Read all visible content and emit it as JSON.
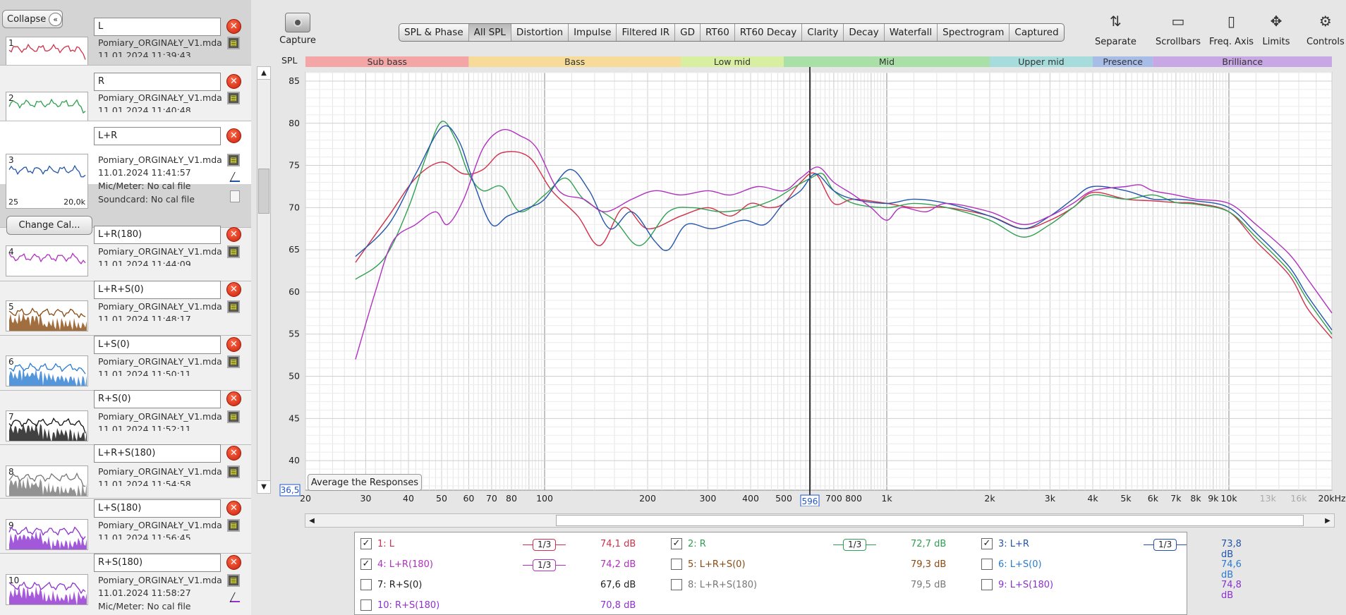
{
  "left_panel": {
    "collapse_label": "Collapse",
    "change_cal_label": "Change Cal...",
    "measurements": [
      {
        "num": "1",
        "name": "L",
        "file": "Pomiary_ORGINAŁY_V1.mdat",
        "date": "11.01.2024 11:39:43",
        "color": "#d0304a"
      },
      {
        "num": "2",
        "name": "R",
        "file": "Pomiary_ORGINAŁY_V1.mdat",
        "date": "11.01.2024 11:40:48",
        "color": "#2fa050"
      },
      {
        "num": "3",
        "name": "L+R",
        "file": "Pomiary_ORGINAŁY_V1.mdat",
        "date": "11.01.2024 11:41:57",
        "color": "#2255aa",
        "mic": "Mic/Meter: No cal file",
        "sound": "Soundcard: No cal file",
        "axis_min": "25",
        "axis_max": "20,0k"
      },
      {
        "num": "4",
        "name": "L+R(180)",
        "file": "Pomiary_ORGINAŁY_V1.mdat",
        "date": "11.01.2024 11:44:09",
        "color": "#b030c0"
      },
      {
        "num": "5",
        "name": "L+R+S(0)",
        "file": "Pomiary_ORGINAŁY_V1.mdat",
        "date": "11.01.2024 11:48:17",
        "color": "#8a4a10"
      },
      {
        "num": "6",
        "name": "L+S(0)",
        "file": "Pomiary_ORGINAŁY_V1.mdat",
        "date": "11.01.2024 11:50:11",
        "color": "#2a7ad0"
      },
      {
        "num": "7",
        "name": "R+S(0)",
        "file": "Pomiary_ORGINAŁY_V1.mdat",
        "date": "11.01.2024 11:52:11",
        "color": "#111111"
      },
      {
        "num": "8",
        "name": "L+R+S(180)",
        "file": "Pomiary_ORGINAŁY_V1.mdat",
        "date": "11.01.2024 11:54:58",
        "color": "#777777"
      },
      {
        "num": "9",
        "name": "L+S(180)",
        "file": "Pomiary_ORGINAŁY_V1.mdat",
        "date": "11.01.2024 11:56:45",
        "color": "#8a30d0"
      },
      {
        "num": "10",
        "name": "R+S(180)",
        "file": "Pomiary_ORGINAŁY_V1.mdat",
        "date": "11.01.2024 11:58:27",
        "color": "#9030d0",
        "mic": "Mic/Meter: No cal file"
      }
    ]
  },
  "toolbar": {
    "capture_label": "Capture",
    "tabs": [
      "SPL & Phase",
      "All SPL",
      "Distortion",
      "Impulse",
      "Filtered IR",
      "GD",
      "RT60",
      "RT60 Decay",
      "Clarity",
      "Decay",
      "Waterfall",
      "Spectrogram",
      "Captured"
    ],
    "active_tab": "All SPL",
    "right_tools": [
      "Separate",
      "Scrollbars",
      "Freq. Axis",
      "Limits",
      "Controls"
    ]
  },
  "chart_data": {
    "type": "line",
    "ylabel": "SPL",
    "ylim": [
      36.5,
      86
    ],
    "y_ticks": [
      85,
      80,
      75,
      70,
      65,
      60,
      55,
      50,
      45,
      40
    ],
    "y_min_label": "36,5",
    "x_scale": "log",
    "xlim": [
      20,
      20000
    ],
    "x_ticks": [
      {
        "v": 20,
        "l": "20"
      },
      {
        "v": 30,
        "l": "30"
      },
      {
        "v": 40,
        "l": "40"
      },
      {
        "v": 50,
        "l": "50"
      },
      {
        "v": 60,
        "l": "60"
      },
      {
        "v": 70,
        "l": "70"
      },
      {
        "v": 80,
        "l": "80"
      },
      {
        "v": 100,
        "l": "100"
      },
      {
        "v": 200,
        "l": "200"
      },
      {
        "v": 300,
        "l": "300"
      },
      {
        "v": 400,
        "l": "400"
      },
      {
        "v": 500,
        "l": "500"
      },
      {
        "v": 700,
        "l": "700"
      },
      {
        "v": 800,
        "l": "800"
      },
      {
        "v": 1000,
        "l": "1k"
      },
      {
        "v": 2000,
        "l": "2k"
      },
      {
        "v": 3000,
        "l": "3k"
      },
      {
        "v": 4000,
        "l": "4k"
      },
      {
        "v": 5000,
        "l": "5k"
      },
      {
        "v": 6000,
        "l": "6k"
      },
      {
        "v": 7000,
        "l": "7k"
      },
      {
        "v": 8000,
        "l": "8k"
      },
      {
        "v": 9000,
        "l": "9k"
      },
      {
        "v": 10000,
        "l": "10k"
      },
      {
        "v": 13000,
        "l": "13k",
        "dim": true
      },
      {
        "v": 16000,
        "l": "16k",
        "dim": true
      },
      {
        "v": 20000,
        "l": "20kHz"
      }
    ],
    "cursor": {
      "x": 596,
      "label": "596"
    },
    "bands": [
      {
        "name": "Sub bass",
        "from": 20,
        "to": 60,
        "color": "#f4a6a6"
      },
      {
        "name": "Bass",
        "from": 60,
        "to": 250,
        "color": "#f6dc98"
      },
      {
        "name": "Low mid",
        "from": 250,
        "to": 500,
        "color": "#d8eea0"
      },
      {
        "name": "Mid",
        "from": 500,
        "to": 2000,
        "color": "#a8e0a8"
      },
      {
        "name": "Upper mid",
        "from": 2000,
        "to": 4000,
        "color": "#a6dcdc"
      },
      {
        "name": "Presence",
        "from": 4000,
        "to": 6000,
        "color": "#a8bce8"
      },
      {
        "name": "Brilliance",
        "from": 6000,
        "to": 20000,
        "color": "#c8a8e4"
      }
    ],
    "series": [
      {
        "name": "1: L",
        "color": "#d0304a",
        "points": [
          [
            28,
            63.5
          ],
          [
            35,
            69
          ],
          [
            42,
            73.5
          ],
          [
            50,
            75.4
          ],
          [
            58,
            74
          ],
          [
            66,
            74.5
          ],
          [
            75,
            76.5
          ],
          [
            90,
            76
          ],
          [
            105,
            72
          ],
          [
            125,
            69
          ],
          [
            145,
            65.5
          ],
          [
            170,
            70
          ],
          [
            200,
            67.5
          ],
          [
            250,
            69
          ],
          [
            300,
            70
          ],
          [
            350,
            69
          ],
          [
            400,
            70.5
          ],
          [
            450,
            70
          ],
          [
            500,
            70.5
          ],
          [
            560,
            73
          ],
          [
            620,
            74
          ],
          [
            700,
            70.5
          ],
          [
            800,
            71
          ],
          [
            1000,
            70.5
          ],
          [
            1200,
            70
          ],
          [
            1500,
            70
          ],
          [
            2000,
            69
          ],
          [
            2500,
            67.5
          ],
          [
            3000,
            68.5
          ],
          [
            3500,
            70
          ],
          [
            4000,
            71.8
          ],
          [
            5000,
            71
          ],
          [
            6000,
            70.8
          ],
          [
            7000,
            70.6
          ],
          [
            8000,
            70.5
          ],
          [
            10000,
            69.5
          ],
          [
            12000,
            66
          ],
          [
            15000,
            62
          ],
          [
            17000,
            58
          ],
          [
            20000,
            54.5
          ]
        ]
      },
      {
        "name": "2: R",
        "color": "#2fa050",
        "points": [
          [
            28,
            61.5
          ],
          [
            34,
            64
          ],
          [
            40,
            70
          ],
          [
            45,
            76
          ],
          [
            50,
            80.2
          ],
          [
            55,
            78
          ],
          [
            60,
            74
          ],
          [
            66,
            72
          ],
          [
            75,
            72.5
          ],
          [
            85,
            69.5
          ],
          [
            100,
            71.5
          ],
          [
            115,
            73.5
          ],
          [
            130,
            71
          ],
          [
            160,
            68.5
          ],
          [
            190,
            65.5
          ],
          [
            230,
            69.5
          ],
          [
            270,
            70
          ],
          [
            330,
            69.5
          ],
          [
            400,
            70
          ],
          [
            470,
            71
          ],
          [
            540,
            72.5
          ],
          [
            600,
            73.5
          ],
          [
            650,
            74
          ],
          [
            700,
            72
          ],
          [
            800,
            70.5
          ],
          [
            1000,
            70
          ],
          [
            1200,
            70.5
          ],
          [
            1500,
            70
          ],
          [
            2000,
            68.5
          ],
          [
            2500,
            66.5
          ],
          [
            3000,
            68
          ],
          [
            3500,
            70
          ],
          [
            4000,
            71.5
          ],
          [
            5000,
            71
          ],
          [
            6000,
            71.5
          ],
          [
            7000,
            70.6
          ],
          [
            8000,
            70.4
          ],
          [
            10000,
            69.5
          ],
          [
            12000,
            66.5
          ],
          [
            15000,
            62.5
          ],
          [
            17000,
            59
          ],
          [
            20000,
            55
          ]
        ]
      },
      {
        "name": "3: L+R",
        "color": "#2255aa",
        "points": [
          [
            28,
            64.2
          ],
          [
            35,
            68
          ],
          [
            42,
            74
          ],
          [
            50,
            79.5
          ],
          [
            56,
            78
          ],
          [
            62,
            73
          ],
          [
            70,
            68
          ],
          [
            78,
            69
          ],
          [
            90,
            70
          ],
          [
            100,
            71
          ],
          [
            118,
            74.5
          ],
          [
            135,
            72
          ],
          [
            155,
            67.5
          ],
          [
            180,
            69.5
          ],
          [
            210,
            66
          ],
          [
            230,
            65
          ],
          [
            260,
            68
          ],
          [
            310,
            67.5
          ],
          [
            380,
            68.5
          ],
          [
            440,
            68
          ],
          [
            500,
            70.5
          ],
          [
            560,
            72
          ],
          [
            620,
            74
          ],
          [
            700,
            72
          ],
          [
            800,
            71
          ],
          [
            1000,
            70.5
          ],
          [
            1200,
            71
          ],
          [
            1500,
            70.5
          ],
          [
            2000,
            69
          ],
          [
            2500,
            67.5
          ],
          [
            3000,
            69
          ],
          [
            3500,
            71
          ],
          [
            4000,
            72.5
          ],
          [
            5000,
            72
          ],
          [
            6000,
            71
          ],
          [
            7000,
            71
          ],
          [
            8000,
            70.8
          ],
          [
            10000,
            70
          ],
          [
            12000,
            67
          ],
          [
            15000,
            63
          ],
          [
            17000,
            59.5
          ],
          [
            20000,
            55.5
          ]
        ]
      },
      {
        "name": "4: L+R(180)",
        "color": "#b030c0",
        "points": [
          [
            28,
            52
          ],
          [
            32,
            60
          ],
          [
            36,
            66
          ],
          [
            42,
            68
          ],
          [
            48,
            69.5
          ],
          [
            52,
            68
          ],
          [
            58,
            71
          ],
          [
            66,
            77
          ],
          [
            75,
            79.2
          ],
          [
            85,
            78.5
          ],
          [
            95,
            77
          ],
          [
            110,
            72
          ],
          [
            130,
            71
          ],
          [
            150,
            69.5
          ],
          [
            180,
            71
          ],
          [
            210,
            72
          ],
          [
            250,
            71.5
          ],
          [
            300,
            72
          ],
          [
            350,
            71.5
          ],
          [
            420,
            72.5
          ],
          [
            500,
            72
          ],
          [
            560,
            73.5
          ],
          [
            630,
            74.8
          ],
          [
            700,
            73
          ],
          [
            800,
            71.5
          ],
          [
            900,
            70
          ],
          [
            1000,
            68.5
          ],
          [
            1100,
            70
          ],
          [
            1300,
            69.5
          ],
          [
            1500,
            70.5
          ],
          [
            2000,
            69.5
          ],
          [
            2500,
            68
          ],
          [
            3000,
            69
          ],
          [
            3500,
            70.5
          ],
          [
            4000,
            72
          ],
          [
            5000,
            72.5
          ],
          [
            5500,
            72.7
          ],
          [
            6000,
            72
          ],
          [
            7000,
            71.5
          ],
          [
            8000,
            71
          ],
          [
            10000,
            70.5
          ],
          [
            12000,
            68
          ],
          [
            15000,
            64.5
          ],
          [
            17000,
            61.5
          ],
          [
            20000,
            57.5
          ]
        ]
      }
    ]
  },
  "avg_button_label": "Average the Responses",
  "legend": [
    {
      "label": "1: L",
      "checked": true,
      "smooth": "1/3",
      "value": "74,1 dB",
      "color": "#d0304a"
    },
    {
      "label": "2: R",
      "checked": true,
      "smooth": "1/3",
      "value": "72,7 dB",
      "color": "#2fa050"
    },
    {
      "label": "3: L+R",
      "checked": true,
      "smooth": "1/3",
      "value": "73,8 dB",
      "color": "#2255aa"
    },
    {
      "label": "4: L+R(180)",
      "checked": true,
      "smooth": "1/3",
      "value": "74,2 dB",
      "color": "#b030c0"
    },
    {
      "label": "5: L+R+S(0)",
      "checked": false,
      "smooth": "",
      "value": "79,3 dB",
      "color": "#8a4a10"
    },
    {
      "label": "6: L+S(0)",
      "checked": false,
      "smooth": "",
      "value": "74,6 dB",
      "color": "#2a7ad0"
    },
    {
      "label": "7: R+S(0)",
      "checked": false,
      "smooth": "",
      "value": "67,6 dB",
      "color": "#222222"
    },
    {
      "label": "8: L+R+S(180)",
      "checked": false,
      "smooth": "",
      "value": "79,5 dB",
      "color": "#777777"
    },
    {
      "label": "9: L+S(180)",
      "checked": false,
      "smooth": "",
      "value": "74,8 dB",
      "color": "#8a30d0"
    },
    {
      "label": "10: R+S(180)",
      "checked": false,
      "smooth": "",
      "value": "70,8 dB",
      "color": "#9030d0"
    }
  ]
}
